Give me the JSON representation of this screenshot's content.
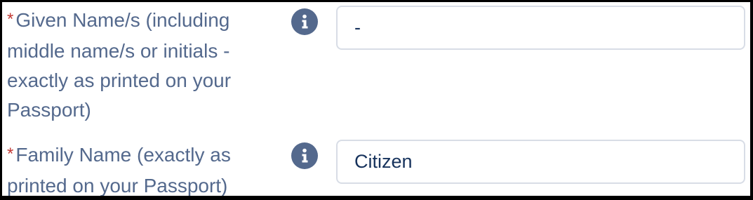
{
  "form": {
    "given_name": {
      "required_marker": "*",
      "label": "Given Name/s (including middle name/s or initials - exactly as printed on your Passport)",
      "info_icon": "info-icon",
      "value": "-"
    },
    "family_name": {
      "required_marker": "*",
      "label": "Family Name (exactly as printed on your Passport)",
      "info_icon": "info-icon",
      "value": "Citizen"
    }
  },
  "colors": {
    "label_text": "#54698d",
    "required_marker": "#c23934",
    "info_icon_bg": "#54698d",
    "input_border": "#d8dde6",
    "input_text": "#16325c",
    "frame_border": "#000000"
  }
}
